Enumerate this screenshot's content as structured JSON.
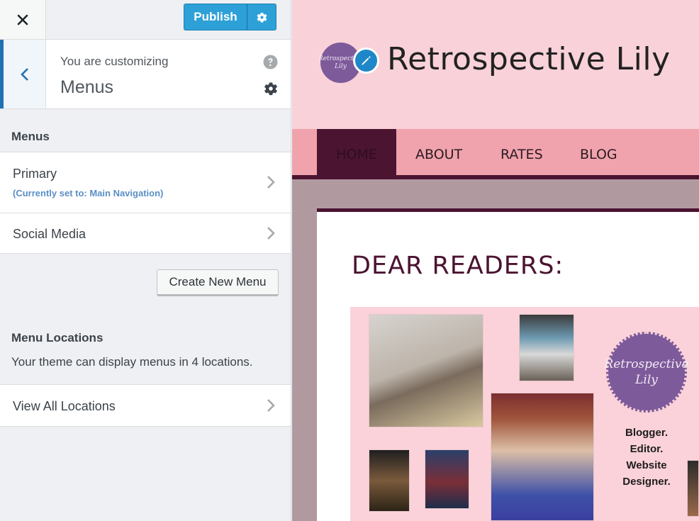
{
  "topbar": {
    "publish_label": "Publish"
  },
  "customizing": {
    "label": "You are customizing",
    "title": "Menus"
  },
  "menus_section": {
    "heading": "Menus",
    "items": [
      {
        "label": "Primary",
        "sub": "(Currently set to: Main Navigation)"
      },
      {
        "label": "Social Media"
      }
    ],
    "create_button": "Create New Menu"
  },
  "locations_section": {
    "heading": "Menu Locations",
    "description": "Your theme can display menus in 4 locations.",
    "view_all": "View All Locations"
  },
  "preview": {
    "site_title": "Retrospective Lily",
    "logo_text": "Retrospective Lily",
    "nav": [
      "HOME",
      "ABOUT",
      "RATES",
      "BLOG"
    ],
    "post_title": "DEAR READERS:",
    "banner": {
      "logo_text": "Retrospective Lily",
      "tagline": "Blogger. Editor. Website Designer."
    }
  },
  "colors": {
    "accent": "#2271b1",
    "publish": "#2ea0d8",
    "site_header_bg": "#f9d1d8",
    "nav_bg": "#f0a3ad",
    "nav_active": "#4b1431"
  }
}
